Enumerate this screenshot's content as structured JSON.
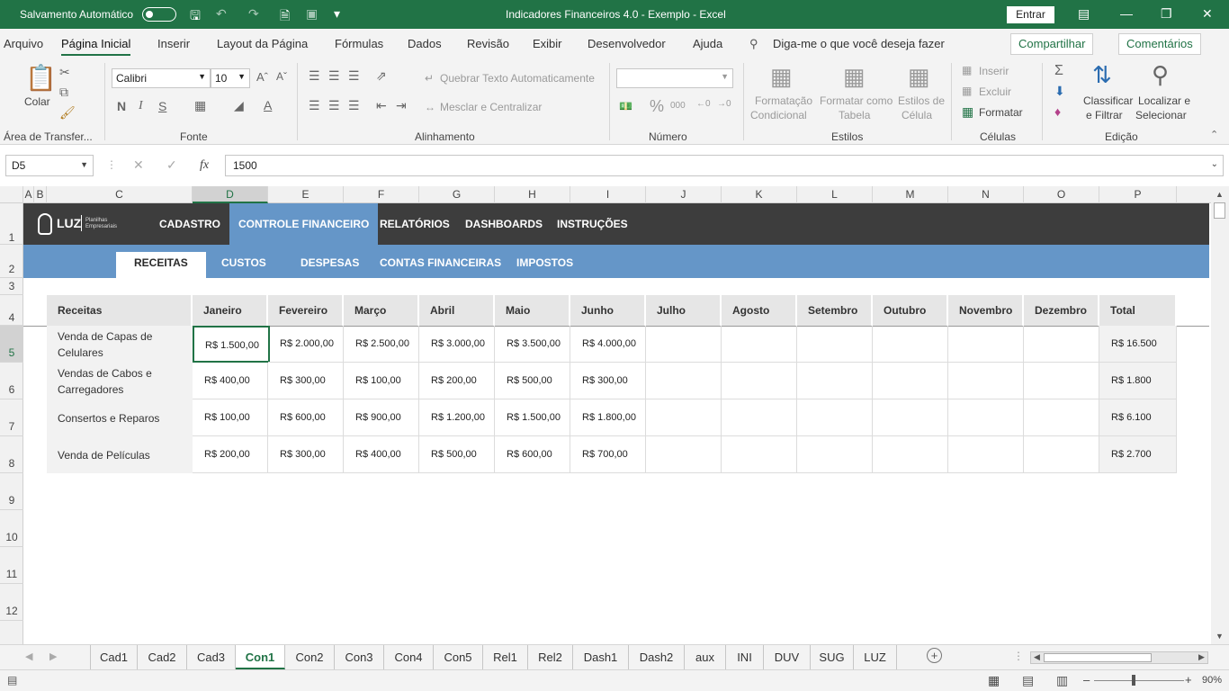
{
  "titlebar": {
    "autosave_label": "Salvamento Automático",
    "title": "Indicadores Financeiros 4.0 - Exemplo  -  Excel",
    "signin": "Entrar"
  },
  "menu": {
    "items": [
      "Arquivo",
      "Página Inicial",
      "Inserir",
      "Layout da Página",
      "Fórmulas",
      "Dados",
      "Revisão",
      "Exibir",
      "Desenvolvedor",
      "Ajuda"
    ],
    "active": "Página Inicial",
    "tell_me": "Diga-me o que você deseja fazer",
    "share": "Compartilhar",
    "comments": "Comentários"
  },
  "ribbon": {
    "paste": "Colar",
    "clipboard_group": "Área de Transfer...",
    "font_name": "Calibri",
    "font_size": "10",
    "bold": "N",
    "italic": "I",
    "underline": "S",
    "font_group": "Fonte",
    "wrap_text": "Quebrar Texto Automaticamente",
    "merge_center": "Mesclar e Centralizar",
    "alignment_group": "Alinhamento",
    "number_format": "",
    "percent": "%",
    "thousands": "000",
    "number_group": "Número",
    "conditional_formatting_1": "Formatação",
    "conditional_formatting_2": "Condicional",
    "format_as_table_1": "Formatar como",
    "format_as_table_2": "Tabela",
    "cell_styles_1": "Estilos de",
    "cell_styles_2": "Célula",
    "styles_group": "Estilos",
    "insert": "Inserir",
    "delete": "Excluir",
    "format": "Formatar",
    "cells_group": "Células",
    "sort_filter_1": "Classificar",
    "sort_filter_2": "e Filtrar",
    "find_select_1": "Localizar e",
    "find_select_2": "Selecionar",
    "editing_group": "Edição"
  },
  "formula_bar": {
    "name_box": "D5",
    "fx": "fx",
    "value": "1500"
  },
  "columns": [
    "A",
    "B",
    "C",
    "D",
    "E",
    "F",
    "G",
    "H",
    "I",
    "J",
    "K",
    "L",
    "M",
    "N",
    "O",
    "P"
  ],
  "rows": [
    "1",
    "2",
    "3",
    "4",
    "5",
    "6",
    "7",
    "8",
    "9",
    "10",
    "11",
    "12"
  ],
  "dashboard": {
    "logo": "LUZ",
    "logo_sub_1": "Planilhas",
    "logo_sub_2": "Empresariais",
    "nav": [
      "CADASTRO",
      "CONTROLE FINANCEIRO",
      "RELATÓRIOS",
      "DASHBOARDS",
      "INSTRUÇÕES"
    ],
    "subnav": [
      "RECEITAS",
      "CUSTOS",
      "DESPESAS",
      "CONTAS FINANCEIRAS",
      "IMPOSTOS"
    ]
  },
  "table": {
    "headers": [
      "Receitas",
      "Janeiro",
      "Fevereiro",
      "Março",
      "Abril",
      "Maio",
      "Junho",
      "Julho",
      "Agosto",
      "Setembro",
      "Outubro",
      "Novembro",
      "Dezembro",
      "Total"
    ],
    "rows": [
      {
        "label_1": "Venda de Capas de",
        "label_2": "Celulares",
        "values": [
          "R$ 1.500,00",
          "R$ 2.000,00",
          "R$ 2.500,00",
          "R$ 3.000,00",
          "R$ 3.500,00",
          "R$ 4.000,00",
          "",
          "",
          "",
          "",
          "",
          ""
        ],
        "total": "R$ 16.500"
      },
      {
        "label_1": "Vendas de Cabos e",
        "label_2": "Carregadores",
        "values": [
          "R$ 400,00",
          "R$ 300,00",
          "R$ 100,00",
          "R$ 200,00",
          "R$ 500,00",
          "R$ 300,00",
          "",
          "",
          "",
          "",
          "",
          ""
        ],
        "total": "R$ 1.800"
      },
      {
        "label_1": "Consertos e Reparos",
        "label_2": "",
        "values": [
          "R$ 100,00",
          "R$ 600,00",
          "R$ 900,00",
          "R$ 1.200,00",
          "R$ 1.500,00",
          "R$ 1.800,00",
          "",
          "",
          "",
          "",
          "",
          ""
        ],
        "total": "R$ 6.100"
      },
      {
        "label_1": "Venda de Películas",
        "label_2": "",
        "values": [
          "R$ 200,00",
          "R$ 300,00",
          "R$ 400,00",
          "R$ 500,00",
          "R$ 600,00",
          "R$ 700,00",
          "",
          "",
          "",
          "",
          "",
          ""
        ],
        "total": "R$ 2.700"
      }
    ]
  },
  "sheet_tabs": [
    "Cad1",
    "Cad2",
    "Cad3",
    "Con1",
    "Con2",
    "Con3",
    "Con4",
    "Con5",
    "Rel1",
    "Rel2",
    "Dash1",
    "Dash2",
    "aux",
    "INI",
    "DUV",
    "SUG",
    "LUZ"
  ],
  "active_sheet": "Con1",
  "status": {
    "zoom": "90%"
  },
  "colors": {
    "excel_green": "#217346",
    "nav_dark": "#3d3d3d",
    "nav_blue": "#6596c8"
  }
}
